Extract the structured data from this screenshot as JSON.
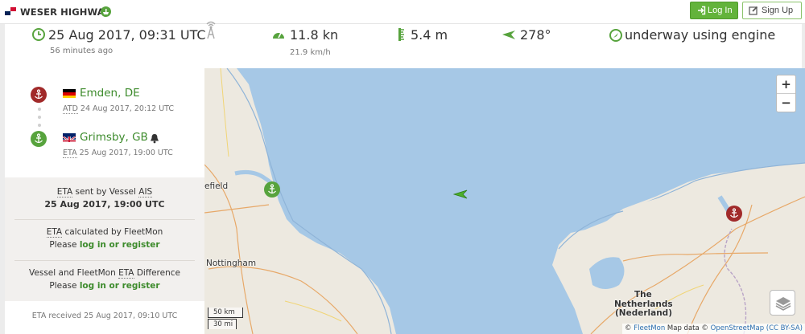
{
  "header": {
    "vessel_name": "WESER HIGHWAY",
    "login_label": "Log In",
    "signup_label": "Sign Up",
    "colors": {
      "accent": "#63b33b",
      "flag_red": "#d21034",
      "flag_blue": "#072357"
    }
  },
  "stats": {
    "timestamp": "25 Aug 2017, 09:31 UTC",
    "time_ago": "56 minutes ago",
    "speed": "11.8 kn",
    "speed_alt": "21.9 km/h",
    "draught": "5.4 m",
    "course": "278°",
    "status": "underway using engine"
  },
  "voyage": {
    "departure": {
      "port": "Emden, DE",
      "label": "ATD",
      "time": "24 Aug 2017, 20:12 UTC",
      "color": "#a12a2a"
    },
    "arrival": {
      "port": "Grimsby, GB",
      "label": "ETA",
      "time": "25 Aug 2017, 19:00 UTC",
      "color": "#57a33d"
    },
    "eta_sent": {
      "prefix": "ETA",
      "middle": " sent by Vessel ",
      "suffix": "AIS",
      "value": "25 Aug 2017, 19:00 UTC"
    },
    "eta_calc": {
      "prefix": "ETA",
      "rest": " calculated by FleetMon",
      "please": "Please ",
      "link": "log in or register"
    },
    "eta_diff": {
      "text1": "Vessel and FleetMon ",
      "abbr": "ETA",
      "text2": " Difference",
      "please": "Please ",
      "link": "log in or register"
    },
    "eta_received": "ETA received 25 Aug 2017, 09:10 UTC"
  },
  "map": {
    "zoom_in": "+",
    "zoom_out": "−",
    "scale_km": "50 km",
    "scale_mi": "30 mi",
    "labels": {
      "sheffield": "efield",
      "nottingham": "Nottingham",
      "the": "The",
      "netherlands": "Netherlands",
      "nederland": "(Nederland)"
    },
    "attribution": {
      "prefix": "© ",
      "fleetmon": "FleetMon",
      "middle": " Map data © ",
      "osm": "OpenStreetMap",
      "license": " (CC BY-SA)"
    },
    "colors": {
      "sea": "#a6c8e6",
      "land": "#ede9e0",
      "vessel": "#4caf2a"
    }
  }
}
